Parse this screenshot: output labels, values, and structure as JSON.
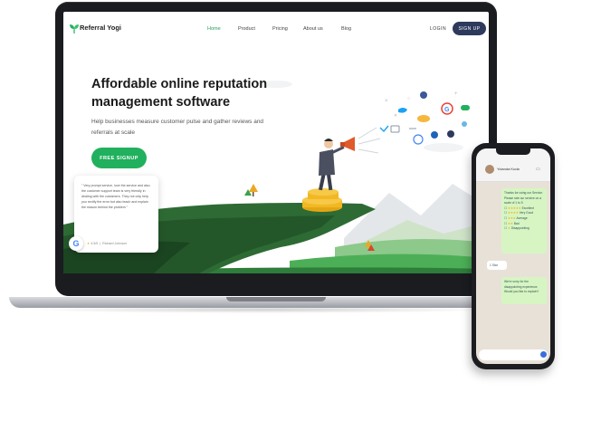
{
  "brand": {
    "name": "Referral Yogi",
    "accent": "#21b05d",
    "dark": "#2d3a5c"
  },
  "nav": {
    "items": [
      "Home",
      "Product",
      "Pricing",
      "About us",
      "Blog"
    ],
    "active": "Home",
    "login_label": "LOGIN",
    "signup_label": "SIGN UP"
  },
  "hero": {
    "title": "Affordable online reputation management software",
    "subtitle": "Help businesses measure customer pulse and gather reviews and referrals at scale",
    "cta_label": "FREE SIGNUP"
  },
  "review": {
    "text": "\" Very prompt service, love the service and also the customer support team is very friendly in dealing with the customers. They not only help you rectify the error but also teach and explain the reason behind the problem \"",
    "rating": "4.5/5",
    "author": "Richard Johnson"
  },
  "phone": {
    "contact": "Yolanda Kuda",
    "msg1": "Thanks for using our Service. Please rate our service on a scale of 1 to 5",
    "options": [
      "Excellent",
      "Very Good",
      "Average",
      "Bad",
      "Disappointing"
    ],
    "reply": "1 Star",
    "msg2": "We're sorry for the disappointing experience. Would you like to explain?"
  }
}
